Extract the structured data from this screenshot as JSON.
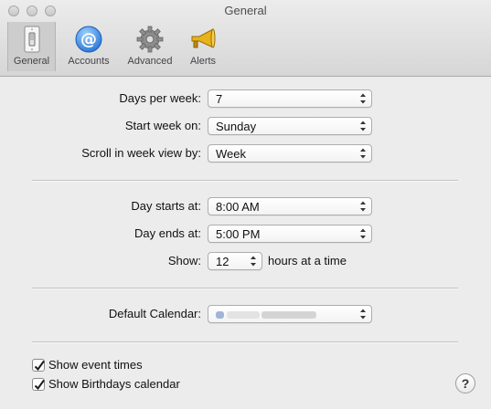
{
  "window": {
    "title": "General"
  },
  "toolbar": {
    "general_label": "General",
    "accounts_label": "Accounts",
    "advanced_label": "Advanced",
    "alerts_label": "Alerts"
  },
  "form": {
    "days_per_week": {
      "label": "Days per week:",
      "value": "7"
    },
    "start_week_on": {
      "label": "Start week on:",
      "value": "Sunday"
    },
    "scroll_week_view": {
      "label": "Scroll in week view by:",
      "value": "Week"
    },
    "day_starts_at": {
      "label": "Day starts at:",
      "value": "8:00 AM"
    },
    "day_ends_at": {
      "label": "Day ends at:",
      "value": "5:00 PM"
    },
    "show": {
      "label": "Show:",
      "value": "12",
      "suffix": "hours at a time"
    },
    "default_calendar": {
      "label": "Default Calendar:"
    }
  },
  "checkboxes": {
    "show_event_times": {
      "label": "Show event times",
      "checked": true
    },
    "show_birthdays": {
      "label": "Show Birthdays calendar",
      "checked": true
    }
  },
  "help": {
    "label": "?"
  }
}
